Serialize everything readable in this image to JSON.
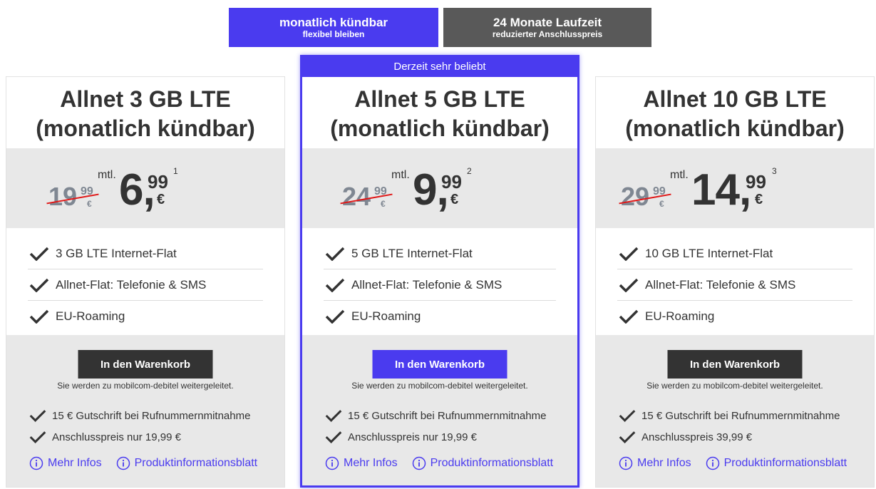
{
  "toggles": [
    {
      "title": "monatlich kündbar",
      "subtitle": "flexibel bleiben",
      "active": true,
      "color": "#4a3bef"
    },
    {
      "title": "24 Monate Laufzeit",
      "subtitle": "reduzierter Anschlusspreis",
      "active": false,
      "color": "#595959"
    }
  ],
  "badge": "Derzeit sehr beliebt",
  "plans": [
    {
      "title_line1": "Allnet 3 GB LTE",
      "title_line2": "(monatlich kündbar)",
      "old_int": "19",
      "old_cents": "99",
      "old_currency": "€",
      "mtl": "mtl.",
      "price_int": "6",
      "price_sep": ",",
      "price_cents": "99",
      "price_currency": "€",
      "footnote": "1",
      "features": [
        "3 GB LTE Internet-Flat",
        "Allnet-Flat: Telefonie & SMS",
        "EU-Roaming"
      ],
      "cart_label": "In den Warenkorb",
      "redirect_note": "Sie werden zu mobilcom-debitel weitergeleitet.",
      "extras": [
        "15 € Gutschrift bei Rufnummernmitnahme",
        "Anschlusspreis nur 19,99 €"
      ],
      "link_more": "Mehr Infos",
      "link_sheet": "Produktinformationsblatt"
    },
    {
      "title_line1": "Allnet 5 GB LTE",
      "title_line2": "(monatlich kündbar)",
      "old_int": "24",
      "old_cents": "99",
      "old_currency": "€",
      "mtl": "mtl.",
      "price_int": "9",
      "price_sep": ",",
      "price_cents": "99",
      "price_currency": "€",
      "footnote": "2",
      "features": [
        "5 GB LTE Internet-Flat",
        "Allnet-Flat: Telefonie & SMS",
        "EU-Roaming"
      ],
      "cart_label": "In den Warenkorb",
      "redirect_note": "Sie werden zu mobilcom-debitel weitergeleitet.",
      "extras": [
        "15 € Gutschrift bei Rufnummernmitnahme",
        "Anschlusspreis nur 19,99 €"
      ],
      "link_more": "Mehr Infos",
      "link_sheet": "Produktinformationsblatt"
    },
    {
      "title_line1": "Allnet 10 GB LTE",
      "title_line2": "(monatlich kündbar)",
      "old_int": "29",
      "old_cents": "99",
      "old_currency": "€",
      "mtl": "mtl.",
      "price_int": "14",
      "price_sep": ",",
      "price_cents": "99",
      "price_currency": "€",
      "footnote": "3",
      "features": [
        "10 GB LTE Internet-Flat",
        "Allnet-Flat: Telefonie & SMS",
        "EU-Roaming"
      ],
      "cart_label": "In den Warenkorb",
      "redirect_note": "Sie werden zu mobilcom-debitel weitergeleitet.",
      "extras": [
        "15 € Gutschrift bei Rufnummernmitnahme",
        "Anschlusspreis 39,99 €"
      ],
      "link_more": "Mehr Infos",
      "link_sheet": "Produktinformationsblatt"
    }
  ],
  "colors": {
    "accent": "#4a3bef",
    "dark": "#333333",
    "strike": "#e01616",
    "panel": "#e8e8e8"
  }
}
